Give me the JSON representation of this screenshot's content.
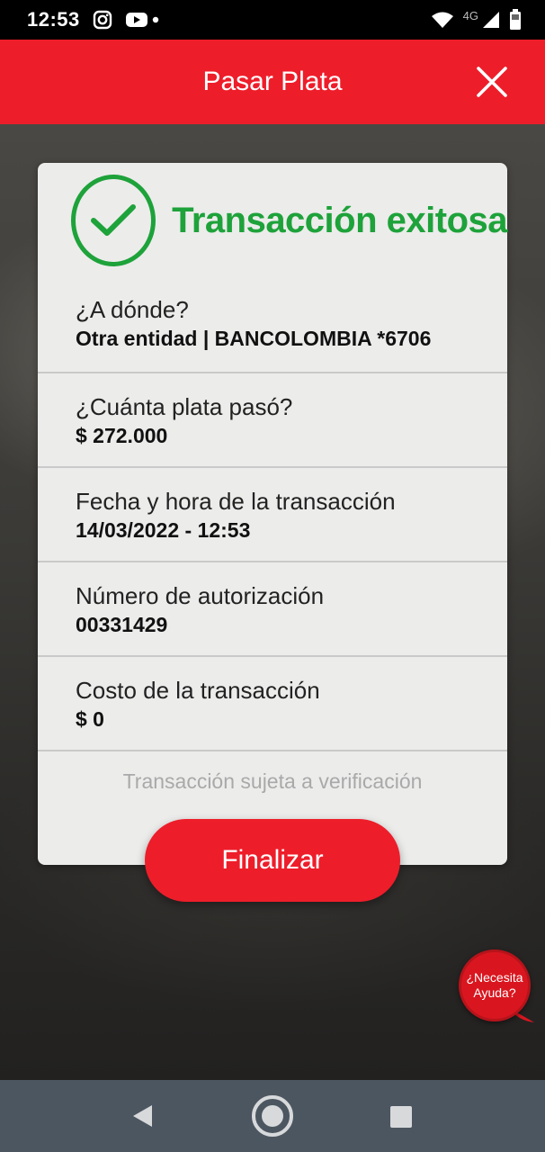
{
  "status_bar": {
    "time": "12:53",
    "network_label": "4G",
    "icons": [
      "instagram-icon",
      "youtube-icon",
      "dot-icon",
      "wifi-icon",
      "signal-icon",
      "battery-icon"
    ]
  },
  "header": {
    "title": "Pasar Plata",
    "close_icon": "close-icon"
  },
  "card": {
    "title": "Transacción exitosa",
    "rows": [
      {
        "label": "¿A dónde?",
        "value": "Otra entidad | BANCOLOMBIA *6706"
      },
      {
        "label": "¿Cuánta plata pasó?",
        "value": "$ 272.000"
      },
      {
        "label": "Fecha y hora de la transacción",
        "value": "14/03/2022 - 12:53"
      },
      {
        "label": "Número de autorización",
        "value": "00331429"
      },
      {
        "label": "Costo de la transacción",
        "value": "$ 0"
      }
    ],
    "note": "Transacción sujeta a verificación"
  },
  "finish_button": {
    "label": "Finalizar"
  },
  "help": {
    "line1": "¿Necesita",
    "line2": "Ayuda?"
  },
  "colors": {
    "brand_red": "#ee1d2a",
    "success_green": "#1ea23a",
    "nav_bar": "#4c5660"
  }
}
